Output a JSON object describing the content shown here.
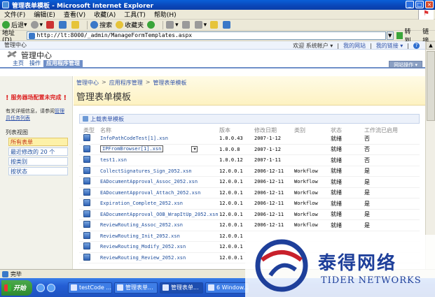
{
  "window": {
    "title": "管理表单模板 - Microsoft Internet Explorer",
    "min": "_",
    "max": "□",
    "close": "×"
  },
  "menu": [
    "文件(F)",
    "编辑(E)",
    "查看(V)",
    "收藏(A)",
    "工具(T)",
    "帮助(H)"
  ],
  "toolbar": {
    "back": "后退",
    "search": "搜索",
    "favorites": "收藏夹"
  },
  "address": {
    "label": "地址(D)",
    "url": "http://lt:8000/_admin/ManageFormTemplates.aspx",
    "go": "转到",
    "links": "链接"
  },
  "sp": {
    "topbar": {
      "site": "管理中心",
      "welcome": "欢迎 系统帐户 ▾",
      "my_site": "我的网站",
      "my_links": "我的链接 ▾",
      "help": "?"
    },
    "site_name": "管理中心",
    "tabs": [
      "主页",
      "操作",
      "应用程序管理"
    ],
    "site_actions": "网站操作 ▾",
    "breadcrumb": [
      "管理中心",
      "应用程序管理",
      "管理表单模板"
    ],
    "page_title": "管理表单模板"
  },
  "leftnav": {
    "warning": "服务器场配置未完成",
    "warning_more": "有关详细信息，请参阅",
    "warning_link": "管理员任务列表",
    "heading": "列表视图",
    "items": [
      "所有表单",
      "最近修改的 20 个",
      "按类别",
      "按状态"
    ]
  },
  "upload": "上载表单模板",
  "table": {
    "headers": [
      "类型",
      "名称",
      "版本",
      "修改日期",
      "类别",
      "状态",
      "工作流已启用"
    ],
    "rows": [
      {
        "name": "InfoPathCodeTest[1].xsn",
        "version": "1.0.0.43",
        "date": "2007-1-12",
        "category": "",
        "status": "就绪",
        "workflow": "否"
      },
      {
        "name": "IPFromBrowser[1].xsn",
        "version": "1.0.0.8",
        "date": "2007-1-12",
        "category": "",
        "status": "就绪",
        "workflow": "否"
      },
      {
        "name": "test1.xsn",
        "version": "1.0.0.12",
        "date": "2007-1-11",
        "category": "",
        "status": "就绪",
        "workflow": "否"
      },
      {
        "name": "CollectSignatures_Sign_2052.xsn",
        "version": "12.0.0.1",
        "date": "2006-12-11",
        "category": "Workflow",
        "status": "就绪",
        "workflow": "是"
      },
      {
        "name": "EADocumentApproval_Assoc_2052.xsn",
        "version": "12.0.0.1",
        "date": "2006-12-11",
        "category": "Workflow",
        "status": "就绪",
        "workflow": "是"
      },
      {
        "name": "EADocumentApproval_Attach_2052.xsn",
        "version": "12.0.0.1",
        "date": "2006-12-11",
        "category": "Workflow",
        "status": "就绪",
        "workflow": "是"
      },
      {
        "name": "Expiration_Complete_2052.xsn",
        "version": "12.0.0.1",
        "date": "2006-12-11",
        "category": "Workflow",
        "status": "就绪",
        "workflow": "是"
      },
      {
        "name": "EADocumentApproval_OOB_WrapItUp_2052.xsn",
        "version": "12.0.0.1",
        "date": "2006-12-11",
        "category": "Workflow",
        "status": "就绪",
        "workflow": "是"
      },
      {
        "name": "ReviewRouting_Assoc_2052.xsn",
        "version": "12.0.0.1",
        "date": "2006-12-11",
        "category": "Workflow",
        "status": "就绪",
        "workflow": "是"
      },
      {
        "name": "ReviewRouting_Init_2052.xsn",
        "version": "12.0.0.1",
        "date": "",
        "category": "",
        "status": "",
        "workflow": ""
      },
      {
        "name": "ReviewRouting_Modify_2052.xsn",
        "version": "12.0.0.1",
        "date": "",
        "category": "",
        "status": "",
        "workflow": ""
      },
      {
        "name": "ReviewRouting_Review_2052.xsn",
        "version": "12.0.0.1",
        "date": "",
        "category": "",
        "status": "",
        "workflow": ""
      }
    ]
  },
  "statusbar": "完毕",
  "taskbar": {
    "start": "开始",
    "tasks": [
      "testCode ...",
      "管理表单...",
      "管理表单...",
      "6 Window..."
    ]
  },
  "watermark": {
    "cn": "泰得网络",
    "en": "TIDER NETWORKS"
  }
}
